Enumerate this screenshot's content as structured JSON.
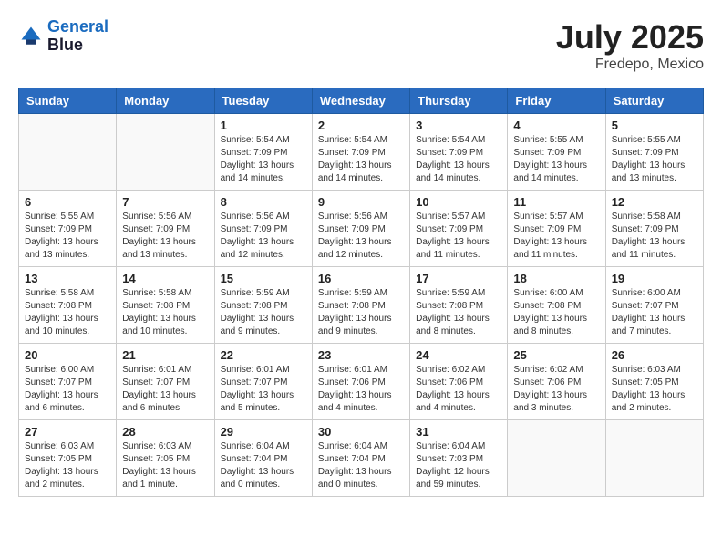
{
  "header": {
    "logo_line1": "General",
    "logo_line2": "Blue",
    "month": "July 2025",
    "location": "Fredepo, Mexico"
  },
  "weekdays": [
    "Sunday",
    "Monday",
    "Tuesday",
    "Wednesday",
    "Thursday",
    "Friday",
    "Saturday"
  ],
  "weeks": [
    [
      {
        "day": "",
        "info": ""
      },
      {
        "day": "",
        "info": ""
      },
      {
        "day": "1",
        "info": "Sunrise: 5:54 AM\nSunset: 7:09 PM\nDaylight: 13 hours\nand 14 minutes."
      },
      {
        "day": "2",
        "info": "Sunrise: 5:54 AM\nSunset: 7:09 PM\nDaylight: 13 hours\nand 14 minutes."
      },
      {
        "day": "3",
        "info": "Sunrise: 5:54 AM\nSunset: 7:09 PM\nDaylight: 13 hours\nand 14 minutes."
      },
      {
        "day": "4",
        "info": "Sunrise: 5:55 AM\nSunset: 7:09 PM\nDaylight: 13 hours\nand 14 minutes."
      },
      {
        "day": "5",
        "info": "Sunrise: 5:55 AM\nSunset: 7:09 PM\nDaylight: 13 hours\nand 13 minutes."
      }
    ],
    [
      {
        "day": "6",
        "info": "Sunrise: 5:55 AM\nSunset: 7:09 PM\nDaylight: 13 hours\nand 13 minutes."
      },
      {
        "day": "7",
        "info": "Sunrise: 5:56 AM\nSunset: 7:09 PM\nDaylight: 13 hours\nand 13 minutes."
      },
      {
        "day": "8",
        "info": "Sunrise: 5:56 AM\nSunset: 7:09 PM\nDaylight: 13 hours\nand 12 minutes."
      },
      {
        "day": "9",
        "info": "Sunrise: 5:56 AM\nSunset: 7:09 PM\nDaylight: 13 hours\nand 12 minutes."
      },
      {
        "day": "10",
        "info": "Sunrise: 5:57 AM\nSunset: 7:09 PM\nDaylight: 13 hours\nand 11 minutes."
      },
      {
        "day": "11",
        "info": "Sunrise: 5:57 AM\nSunset: 7:09 PM\nDaylight: 13 hours\nand 11 minutes."
      },
      {
        "day": "12",
        "info": "Sunrise: 5:58 AM\nSunset: 7:09 PM\nDaylight: 13 hours\nand 11 minutes."
      }
    ],
    [
      {
        "day": "13",
        "info": "Sunrise: 5:58 AM\nSunset: 7:08 PM\nDaylight: 13 hours\nand 10 minutes."
      },
      {
        "day": "14",
        "info": "Sunrise: 5:58 AM\nSunset: 7:08 PM\nDaylight: 13 hours\nand 10 minutes."
      },
      {
        "day": "15",
        "info": "Sunrise: 5:59 AM\nSunset: 7:08 PM\nDaylight: 13 hours\nand 9 minutes."
      },
      {
        "day": "16",
        "info": "Sunrise: 5:59 AM\nSunset: 7:08 PM\nDaylight: 13 hours\nand 9 minutes."
      },
      {
        "day": "17",
        "info": "Sunrise: 5:59 AM\nSunset: 7:08 PM\nDaylight: 13 hours\nand 8 minutes."
      },
      {
        "day": "18",
        "info": "Sunrise: 6:00 AM\nSunset: 7:08 PM\nDaylight: 13 hours\nand 8 minutes."
      },
      {
        "day": "19",
        "info": "Sunrise: 6:00 AM\nSunset: 7:07 PM\nDaylight: 13 hours\nand 7 minutes."
      }
    ],
    [
      {
        "day": "20",
        "info": "Sunrise: 6:00 AM\nSunset: 7:07 PM\nDaylight: 13 hours\nand 6 minutes."
      },
      {
        "day": "21",
        "info": "Sunrise: 6:01 AM\nSunset: 7:07 PM\nDaylight: 13 hours\nand 6 minutes."
      },
      {
        "day": "22",
        "info": "Sunrise: 6:01 AM\nSunset: 7:07 PM\nDaylight: 13 hours\nand 5 minutes."
      },
      {
        "day": "23",
        "info": "Sunrise: 6:01 AM\nSunset: 7:06 PM\nDaylight: 13 hours\nand 4 minutes."
      },
      {
        "day": "24",
        "info": "Sunrise: 6:02 AM\nSunset: 7:06 PM\nDaylight: 13 hours\nand 4 minutes."
      },
      {
        "day": "25",
        "info": "Sunrise: 6:02 AM\nSunset: 7:06 PM\nDaylight: 13 hours\nand 3 minutes."
      },
      {
        "day": "26",
        "info": "Sunrise: 6:03 AM\nSunset: 7:05 PM\nDaylight: 13 hours\nand 2 minutes."
      }
    ],
    [
      {
        "day": "27",
        "info": "Sunrise: 6:03 AM\nSunset: 7:05 PM\nDaylight: 13 hours\nand 2 minutes."
      },
      {
        "day": "28",
        "info": "Sunrise: 6:03 AM\nSunset: 7:05 PM\nDaylight: 13 hours\nand 1 minute."
      },
      {
        "day": "29",
        "info": "Sunrise: 6:04 AM\nSunset: 7:04 PM\nDaylight: 13 hours\nand 0 minutes."
      },
      {
        "day": "30",
        "info": "Sunrise: 6:04 AM\nSunset: 7:04 PM\nDaylight: 13 hours\nand 0 minutes."
      },
      {
        "day": "31",
        "info": "Sunrise: 6:04 AM\nSunset: 7:03 PM\nDaylight: 12 hours\nand 59 minutes."
      },
      {
        "day": "",
        "info": ""
      },
      {
        "day": "",
        "info": ""
      }
    ]
  ]
}
